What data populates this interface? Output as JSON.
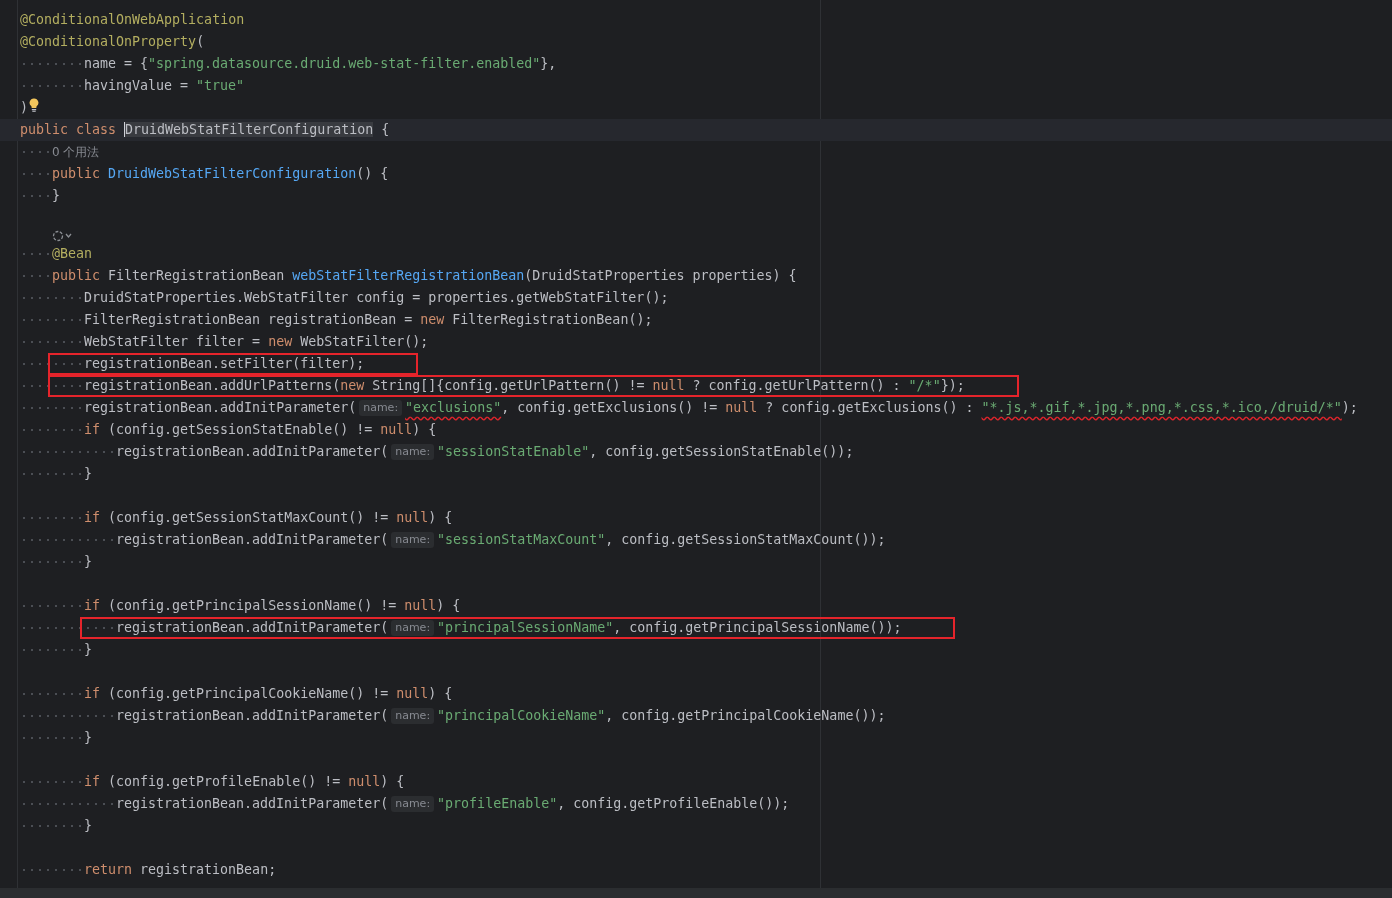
{
  "editor": {
    "lines": [
      {
        "kind": "code",
        "boxed": false,
        "tokens": [
          {
            "kind": "ann",
            "text": "@ConditionalOnWebApplication"
          }
        ]
      },
      {
        "kind": "code",
        "boxed": false,
        "tokens": [
          {
            "kind": "ann",
            "text": "@ConditionalOnProperty"
          },
          {
            "kind": "plain",
            "text": "("
          }
        ],
        "children": [
          {
            "kind": "group",
            "children": [
              {
                "kind": "code",
                "boxed": false,
                "tokens": [
                  {
                    "kind": "plain",
                    "text": "name = {"
                  },
                  {
                    "kind": "str",
                    "text": "\"spring.datasource.druid.web-stat-filter.enabled\""
                  },
                  {
                    "kind": "plain",
                    "text": "},"
                  }
                ]
              },
              {
                "kind": "code",
                "boxed": false,
                "tokens": [
                  {
                    "kind": "plain",
                    "text": "havingValue = "
                  },
                  {
                    "kind": "str",
                    "text": "\"true\""
                  }
                ]
              }
            ]
          }
        ]
      },
      {
        "kind": "bulb",
        "boxed": false,
        "tokens": [
          {
            "kind": "plain",
            "text": ")"
          }
        ]
      },
      {
        "kind": "current",
        "boxed": false,
        "tokens": [
          {
            "kind": "kw",
            "text": "public class "
          },
          {
            "kind": "sel",
            "text": "DruidWebStatFilterConfiguration"
          },
          {
            "kind": "plain",
            "text": " {"
          }
        ],
        "children": [
          {
            "kind": "usage",
            "boxed": false,
            "tokens": [
              {
                "kind": "usage",
                "text": "0 个用法"
              }
            ]
          },
          {
            "kind": "code",
            "boxed": false,
            "tokens": [
              {
                "kind": "kw",
                "text": "public "
              },
              {
                "kind": "fn",
                "text": "DruidWebStatFilterConfiguration"
              },
              {
                "kind": "plain",
                "text": "() {"
              }
            ]
          },
          {
            "kind": "code",
            "boxed": false,
            "tokens": [
              {
                "kind": "plain",
                "text": "}"
              }
            ]
          },
          {
            "kind": "blank",
            "boxed": false
          },
          {
            "kind": "icons",
            "boxed": false
          },
          {
            "kind": "code",
            "boxed": false,
            "tokens": [
              {
                "kind": "ann",
                "text": "@Bean"
              }
            ]
          },
          {
            "kind": "code",
            "boxed": false,
            "tokens": [
              {
                "kind": "kw",
                "text": "public "
              },
              {
                "kind": "plain",
                "text": "FilterRegistrationBean "
              },
              {
                "kind": "fn",
                "text": "webStatFilterRegistrationBean"
              },
              {
                "kind": "plain",
                "text": "(DruidStatProperties properties) {"
              }
            ],
            "children": [
              {
                "kind": "code",
                "boxed": false,
                "tokens": [
                  {
                    "kind": "plain",
                    "text": "DruidStatProperties.WebStatFilter config = properties.getWebStatFilter();"
                  }
                ]
              },
              {
                "kind": "code",
                "boxed": false,
                "tokens": [
                  {
                    "kind": "plain",
                    "text": "FilterRegistrationBean registrationBean = "
                  },
                  {
                    "kind": "kw",
                    "text": "new "
                  },
                  {
                    "kind": "plain",
                    "text": "FilterRegistrationBean();"
                  }
                ]
              },
              {
                "kind": "code",
                "boxed": false,
                "tokens": [
                  {
                    "kind": "plain",
                    "text": "WebStatFilter filter = "
                  },
                  {
                    "kind": "kw",
                    "text": "new "
                  },
                  {
                    "kind": "plain",
                    "text": "WebStatFilter();"
                  }
                ]
              },
              {
                "kind": "code",
                "boxed": true,
                "tokens": [
                  {
                    "kind": "plain",
                    "text": "registrationBean.setFilter(filter);"
                  }
                ]
              },
              {
                "kind": "code",
                "boxed": true,
                "tokens": [
                  {
                    "kind": "plain",
                    "text": "registrationBean.addUrlPatterns("
                  },
                  {
                    "kind": "kw",
                    "text": "new "
                  },
                  {
                    "kind": "plain",
                    "text": "String[]{config.getUrlPattern() != "
                  },
                  {
                    "kind": "kw",
                    "text": "null "
                  },
                  {
                    "kind": "plain",
                    "text": "? config.getUrlPattern() : "
                  },
                  {
                    "kind": "str",
                    "text": "\"/*\""
                  },
                  {
                    "kind": "plain",
                    "text": "});"
                  }
                ]
              },
              {
                "kind": "code",
                "boxed": false,
                "tokens": [
                  {
                    "kind": "plain",
                    "text": "registrationBean.addInitParameter("
                  },
                  {
                    "kind": "hint",
                    "text": "name:"
                  },
                  {
                    "kind": "str_marked",
                    "text": "\"exclusions\""
                  },
                  {
                    "kind": "plain",
                    "text": ", config.getExclusions() != "
                  },
                  {
                    "kind": "kw",
                    "text": "null "
                  },
                  {
                    "kind": "plain",
                    "text": "? config.getExclusions() : "
                  },
                  {
                    "kind": "str_marked",
                    "text": "\"*.js,*.gif,*.jpg,*.png,*.css,*.ico,/druid/*\""
                  },
                  {
                    "kind": "plain",
                    "text": ");"
                  }
                ]
              },
              {
                "kind": "code",
                "boxed": false,
                "tokens": [
                  {
                    "kind": "kw",
                    "text": "if "
                  },
                  {
                    "kind": "plain",
                    "text": "(config.getSessionStatEnable() != "
                  },
                  {
                    "kind": "kw",
                    "text": "null"
                  },
                  {
                    "kind": "plain",
                    "text": ") {"
                  }
                ],
                "children": [
                  {
                    "kind": "code",
                    "boxed": false,
                    "tokens": [
                      {
                        "kind": "plain",
                        "text": "registrationBean.addInitParameter("
                      },
                      {
                        "kind": "hint",
                        "text": "name:"
                      },
                      {
                        "kind": "str",
                        "text": "\"sessionStatEnable\""
                      },
                      {
                        "kind": "plain",
                        "text": ", config.getSessionStatEnable());"
                      }
                    ]
                  }
                ]
              },
              {
                "kind": "code",
                "boxed": false,
                "tokens": [
                  {
                    "kind": "plain",
                    "text": "}"
                  }
                ]
              },
              {
                "kind": "blank",
                "boxed": false
              },
              {
                "kind": "code",
                "boxed": false,
                "tokens": [
                  {
                    "kind": "kw",
                    "text": "if "
                  },
                  {
                    "kind": "plain",
                    "text": "(config.getSessionStatMaxCount() != "
                  },
                  {
                    "kind": "kw",
                    "text": "null"
                  },
                  {
                    "kind": "plain",
                    "text": ") {"
                  }
                ],
                "children": [
                  {
                    "kind": "code",
                    "boxed": false,
                    "tokens": [
                      {
                        "kind": "plain",
                        "text": "registrationBean.addInitParameter("
                      },
                      {
                        "kind": "hint",
                        "text": "name:"
                      },
                      {
                        "kind": "str",
                        "text": "\"sessionStatMaxCount\""
                      },
                      {
                        "kind": "plain",
                        "text": ", config.getSessionStatMaxCount());"
                      }
                    ]
                  }
                ]
              },
              {
                "kind": "code",
                "boxed": false,
                "tokens": [
                  {
                    "kind": "plain",
                    "text": "}"
                  }
                ]
              },
              {
                "kind": "blank",
                "boxed": false
              },
              {
                "kind": "code",
                "boxed": false,
                "tokens": [
                  {
                    "kind": "kw",
                    "text": "if "
                  },
                  {
                    "kind": "plain",
                    "text": "(config.getPrincipalSessionName() != "
                  },
                  {
                    "kind": "kw",
                    "text": "null"
                  },
                  {
                    "kind": "plain",
                    "text": ") {"
                  }
                ],
                "children": [
                  {
                    "kind": "code",
                    "boxed": true,
                    "tokens": [
                      {
                        "kind": "plain",
                        "text": "registrationBean.addInitParameter("
                      },
                      {
                        "kind": "hint",
                        "text": "name:"
                      },
                      {
                        "kind": "str",
                        "text": "\"principalSessionName\""
                      },
                      {
                        "kind": "plain",
                        "text": ", config.getPrincipalSessionName());"
                      }
                    ]
                  }
                ]
              },
              {
                "kind": "code",
                "boxed": false,
                "tokens": [
                  {
                    "kind": "plain",
                    "text": "}"
                  }
                ]
              },
              {
                "kind": "blank",
                "boxed": false
              },
              {
                "kind": "code",
                "boxed": false,
                "tokens": [
                  {
                    "kind": "kw",
                    "text": "if "
                  },
                  {
                    "kind": "plain",
                    "text": "(config.getPrincipalCookieName() != "
                  },
                  {
                    "kind": "kw",
                    "text": "null"
                  },
                  {
                    "kind": "plain",
                    "text": ") {"
                  }
                ],
                "children": [
                  {
                    "kind": "code",
                    "boxed": false,
                    "tokens": [
                      {
                        "kind": "plain",
                        "text": "registrationBean.addInitParameter("
                      },
                      {
                        "kind": "hint",
                        "text": "name:"
                      },
                      {
                        "kind": "str",
                        "text": "\"principalCookieName\""
                      },
                      {
                        "kind": "plain",
                        "text": ", config.getPrincipalCookieName());"
                      }
                    ]
                  }
                ]
              },
              {
                "kind": "code",
                "boxed": false,
                "tokens": [
                  {
                    "kind": "plain",
                    "text": "}"
                  }
                ]
              },
              {
                "kind": "blank",
                "boxed": false
              },
              {
                "kind": "code",
                "boxed": false,
                "tokens": [
                  {
                    "kind": "kw",
                    "text": "if "
                  },
                  {
                    "kind": "plain",
                    "text": "(config.getProfileEnable() != "
                  },
                  {
                    "kind": "kw",
                    "text": "null"
                  },
                  {
                    "kind": "plain",
                    "text": ") {"
                  }
                ],
                "children": [
                  {
                    "kind": "code",
                    "boxed": false,
                    "tokens": [
                      {
                        "kind": "plain",
                        "text": "registrationBean.addInitParameter("
                      },
                      {
                        "kind": "hint",
                        "text": "name:"
                      },
                      {
                        "kind": "str",
                        "text": "\"profileEnable\""
                      },
                      {
                        "kind": "plain",
                        "text": ", config.getProfileEnable());"
                      }
                    ]
                  }
                ]
              },
              {
                "kind": "code",
                "boxed": false,
                "tokens": [
                  {
                    "kind": "plain",
                    "text": "}"
                  }
                ]
              },
              {
                "kind": "blank",
                "boxed": false
              },
              {
                "kind": "code",
                "boxed": false,
                "tokens": [
                  {
                    "kind": "kw",
                    "text": "return "
                  },
                  {
                    "kind": "plain",
                    "text": "registrationBean;"
                  }
                ]
              }
            ]
          }
        ]
      }
    ]
  }
}
